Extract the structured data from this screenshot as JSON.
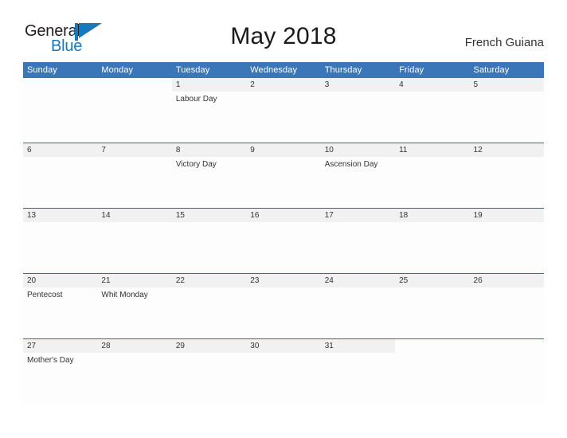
{
  "brand": {
    "name_part1": "General",
    "name_part2": "Blue",
    "logo_icon": "blue-pennant-flag-icon",
    "color_dark": "#231f20",
    "color_blue": "#1878be"
  },
  "header": {
    "month_title": "May 2018",
    "location": "French Guiana"
  },
  "theme": {
    "header_bar": "#3a76b8",
    "row_divider": "#2e6da4",
    "daynum_band": "#f1f1f1",
    "cell_background": "#fdfdfd",
    "text": "#333333"
  },
  "calendar": {
    "weekday_headers": [
      "Sunday",
      "Monday",
      "Tuesday",
      "Wednesday",
      "Thursday",
      "Friday",
      "Saturday"
    ],
    "weeks": [
      [
        {
          "day": "",
          "events": []
        },
        {
          "day": "",
          "events": []
        },
        {
          "day": "1",
          "events": [
            "Labour Day"
          ]
        },
        {
          "day": "2",
          "events": []
        },
        {
          "day": "3",
          "events": []
        },
        {
          "day": "4",
          "events": []
        },
        {
          "day": "5",
          "events": []
        }
      ],
      [
        {
          "day": "6",
          "events": []
        },
        {
          "day": "7",
          "events": []
        },
        {
          "day": "8",
          "events": [
            "Victory Day"
          ]
        },
        {
          "day": "9",
          "events": []
        },
        {
          "day": "10",
          "events": [
            "Ascension Day"
          ]
        },
        {
          "day": "11",
          "events": []
        },
        {
          "day": "12",
          "events": []
        }
      ],
      [
        {
          "day": "13",
          "events": []
        },
        {
          "day": "14",
          "events": []
        },
        {
          "day": "15",
          "events": []
        },
        {
          "day": "16",
          "events": []
        },
        {
          "day": "17",
          "events": []
        },
        {
          "day": "18",
          "events": []
        },
        {
          "day": "19",
          "events": []
        }
      ],
      [
        {
          "day": "20",
          "events": [
            "Pentecost"
          ]
        },
        {
          "day": "21",
          "events": [
            "Whit Monday"
          ]
        },
        {
          "day": "22",
          "events": []
        },
        {
          "day": "23",
          "events": []
        },
        {
          "day": "24",
          "events": []
        },
        {
          "day": "25",
          "events": []
        },
        {
          "day": "26",
          "events": []
        }
      ],
      [
        {
          "day": "27",
          "events": [
            "Mother's Day"
          ]
        },
        {
          "day": "28",
          "events": []
        },
        {
          "day": "29",
          "events": []
        },
        {
          "day": "30",
          "events": []
        },
        {
          "day": "31",
          "events": []
        },
        {
          "day": "",
          "events": []
        },
        {
          "day": "",
          "events": []
        }
      ]
    ]
  }
}
